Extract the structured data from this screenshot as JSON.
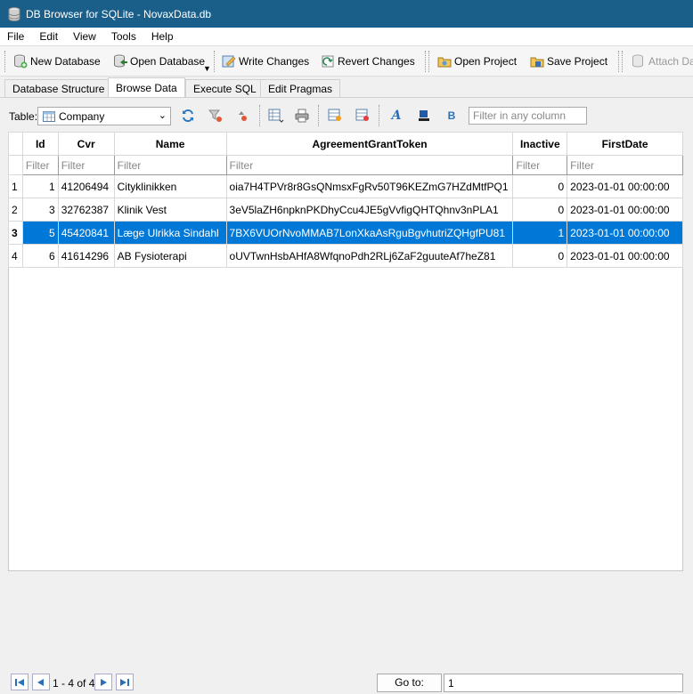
{
  "window": {
    "title": "DB Browser for SQLite - NovaxData.db"
  },
  "menu": {
    "items": [
      "File",
      "Edit",
      "View",
      "Tools",
      "Help"
    ]
  },
  "toolbar": {
    "new_database": "New Database",
    "open_database": "Open Database",
    "write_changes": "Write Changes",
    "revert_changes": "Revert Changes",
    "open_project": "Open Project",
    "save_project": "Save Project",
    "attach_database": "Attach Dat"
  },
  "tabs": [
    "Database Structure",
    "Browse Data",
    "Execute SQL",
    "Edit Pragmas"
  ],
  "active_tab": "Browse Data",
  "browse": {
    "table_label": "Table:",
    "table_selected": "Company",
    "filter_any_placeholder": "Filter in any column"
  },
  "grid": {
    "columns": [
      "Id",
      "Cvr",
      "Name",
      "AgreementGrantToken",
      "Inactive",
      "FirstDate"
    ],
    "filter_placeholder": "Filter",
    "rows": [
      {
        "rownum": "1",
        "cells": [
          "1",
          "41206494",
          "Cityklinikken",
          "oia7H4TPVr8r8GsQNmsxFgRv50T96KEZmG7HZdMtfPQ1",
          "0",
          "2023-01-01 00:00:00"
        ]
      },
      {
        "rownum": "2",
        "cells": [
          "3",
          "32762387",
          "Klinik Vest",
          "3eV5laZH6npknPKDhyCcu4JE5gVvfigQHTQhnv3nPLA1",
          "0",
          "2023-01-01 00:00:00"
        ]
      },
      {
        "rownum": "3",
        "cells": [
          "5",
          "45420841",
          "Læge Ulrikka Sindahl",
          "7BX6VUOrNvoMMAB7LonXkaAsRguBgvhutriZQHgfPU81",
          "1",
          "2023-01-01 00:00:00"
        ]
      },
      {
        "rownum": "4",
        "cells": [
          "6",
          "41614296",
          "AB Fysioterapi",
          "oUVTwnHsbAHfA8WfqnoPdh2RLj6ZaF2guuteAf7heZ81",
          "0",
          "2023-01-01 00:00:00"
        ]
      }
    ],
    "selected_row": 2,
    "selection_color": "#0078d7"
  },
  "pager": {
    "record_label": "1 - 4 of 4",
    "goto_label": "Go to:",
    "goto_value": "1"
  }
}
